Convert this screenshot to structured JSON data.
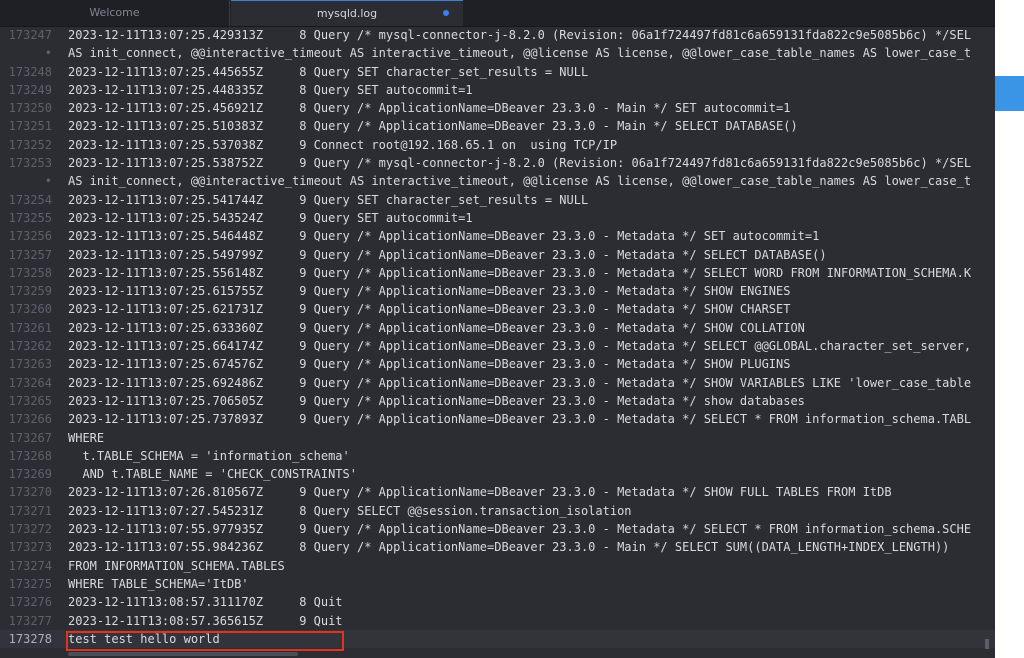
{
  "tabs": [
    {
      "label": "Welcome",
      "active": false
    },
    {
      "label": "mysqld.log",
      "active": true,
      "modified": true
    }
  ],
  "editor": {
    "lines": [
      {
        "num": "173247",
        "text": "2023-12-11T13:07:25.429313Z     8 Query /* mysql-connector-j-8.2.0 (Revision: 06a1f724497fd81c6a659131fda822c9e5085b6c) */SEL"
      },
      {
        "num": "•",
        "text": "AS init_connect, @@interactive_timeout AS interactive_timeout, @@license AS license, @@lower_case_table_names AS lower_case_t"
      },
      {
        "num": "173248",
        "text": "2023-12-11T13:07:25.445655Z     8 Query SET character_set_results = NULL"
      },
      {
        "num": "173249",
        "text": "2023-12-11T13:07:25.448335Z     8 Query SET autocommit=1"
      },
      {
        "num": "173250",
        "text": "2023-12-11T13:07:25.456921Z     8 Query /* ApplicationName=DBeaver 23.3.0 - Main */ SET autocommit=1"
      },
      {
        "num": "173251",
        "text": "2023-12-11T13:07:25.510383Z     8 Query /* ApplicationName=DBeaver 23.3.0 - Main */ SELECT DATABASE()"
      },
      {
        "num": "173252",
        "text": "2023-12-11T13:07:25.537038Z     9 Connect root@192.168.65.1 on  using TCP/IP"
      },
      {
        "num": "173253",
        "text": "2023-12-11T13:07:25.538752Z     9 Query /* mysql-connector-j-8.2.0 (Revision: 06a1f724497fd81c6a659131fda822c9e5085b6c) */SEL"
      },
      {
        "num": "•",
        "text": "AS init_connect, @@interactive_timeout AS interactive_timeout, @@license AS license, @@lower_case_table_names AS lower_case_t"
      },
      {
        "num": "173254",
        "text": "2023-12-11T13:07:25.541744Z     9 Query SET character_set_results = NULL"
      },
      {
        "num": "173255",
        "text": "2023-12-11T13:07:25.543524Z     9 Query SET autocommit=1"
      },
      {
        "num": "173256",
        "text": "2023-12-11T13:07:25.546448Z     9 Query /* ApplicationName=DBeaver 23.3.0 - Metadata */ SET autocommit=1"
      },
      {
        "num": "173257",
        "text": "2023-12-11T13:07:25.549799Z     9 Query /* ApplicationName=DBeaver 23.3.0 - Metadata */ SELECT DATABASE()"
      },
      {
        "num": "173258",
        "text": "2023-12-11T13:07:25.556148Z     9 Query /* ApplicationName=DBeaver 23.3.0 - Metadata */ SELECT WORD FROM INFORMATION_SCHEMA.K"
      },
      {
        "num": "173259",
        "text": "2023-12-11T13:07:25.615755Z     9 Query /* ApplicationName=DBeaver 23.3.0 - Metadata */ SHOW ENGINES"
      },
      {
        "num": "173260",
        "text": "2023-12-11T13:07:25.621731Z     9 Query /* ApplicationName=DBeaver 23.3.0 - Metadata */ SHOW CHARSET"
      },
      {
        "num": "173261",
        "text": "2023-12-11T13:07:25.633360Z     9 Query /* ApplicationName=DBeaver 23.3.0 - Metadata */ SHOW COLLATION"
      },
      {
        "num": "173262",
        "text": "2023-12-11T13:07:25.664174Z     9 Query /* ApplicationName=DBeaver 23.3.0 - Metadata */ SELECT @@GLOBAL.character_set_server,"
      },
      {
        "num": "173263",
        "text": "2023-12-11T13:07:25.674576Z     9 Query /* ApplicationName=DBeaver 23.3.0 - Metadata */ SHOW PLUGINS"
      },
      {
        "num": "173264",
        "text": "2023-12-11T13:07:25.692486Z     9 Query /* ApplicationName=DBeaver 23.3.0 - Metadata */ SHOW VARIABLES LIKE 'lower_case_table"
      },
      {
        "num": "173265",
        "text": "2023-12-11T13:07:25.706505Z     9 Query /* ApplicationName=DBeaver 23.3.0 - Metadata */ show databases"
      },
      {
        "num": "173266",
        "text": "2023-12-11T13:07:25.737893Z     9 Query /* ApplicationName=DBeaver 23.3.0 - Metadata */ SELECT * FROM information_schema.TABL"
      },
      {
        "num": "173267",
        "text": "WHERE"
      },
      {
        "num": "173268",
        "text": "  t.TABLE_SCHEMA = 'information_schema'"
      },
      {
        "num": "173269",
        "text": "  AND t.TABLE_NAME = 'CHECK_CONSTRAINTS'"
      },
      {
        "num": "173270",
        "text": "2023-12-11T13:07:26.810567Z     9 Query /* ApplicationName=DBeaver 23.3.0 - Metadata */ SHOW FULL TABLES FROM ItDB"
      },
      {
        "num": "173271",
        "text": "2023-12-11T13:07:27.545231Z     8 Query SELECT @@session.transaction_isolation"
      },
      {
        "num": "173272",
        "text": "2023-12-11T13:07:55.977935Z     9 Query /* ApplicationName=DBeaver 23.3.0 - Metadata */ SELECT * FROM information_schema.SCHE"
      },
      {
        "num": "173273",
        "text": "2023-12-11T13:07:55.984236Z     8 Query /* ApplicationName=DBeaver 23.3.0 - Main */ SELECT SUM((DATA_LENGTH+INDEX_LENGTH))"
      },
      {
        "num": "173274",
        "text": "FROM INFORMATION_SCHEMA.TABLES"
      },
      {
        "num": "173275",
        "text": "WHERE TABLE_SCHEMA='ItDB'"
      },
      {
        "num": "173276",
        "text": "2023-12-11T13:08:57.311170Z     8 Quit"
      },
      {
        "num": "173277",
        "text": "2023-12-11T13:08:57.365615Z     9 Quit"
      },
      {
        "num": "173278",
        "text": "test test hello world",
        "current": true
      }
    ]
  },
  "colors": {
    "highlight_box": "#e3321f",
    "accent": "#3b95e6"
  }
}
